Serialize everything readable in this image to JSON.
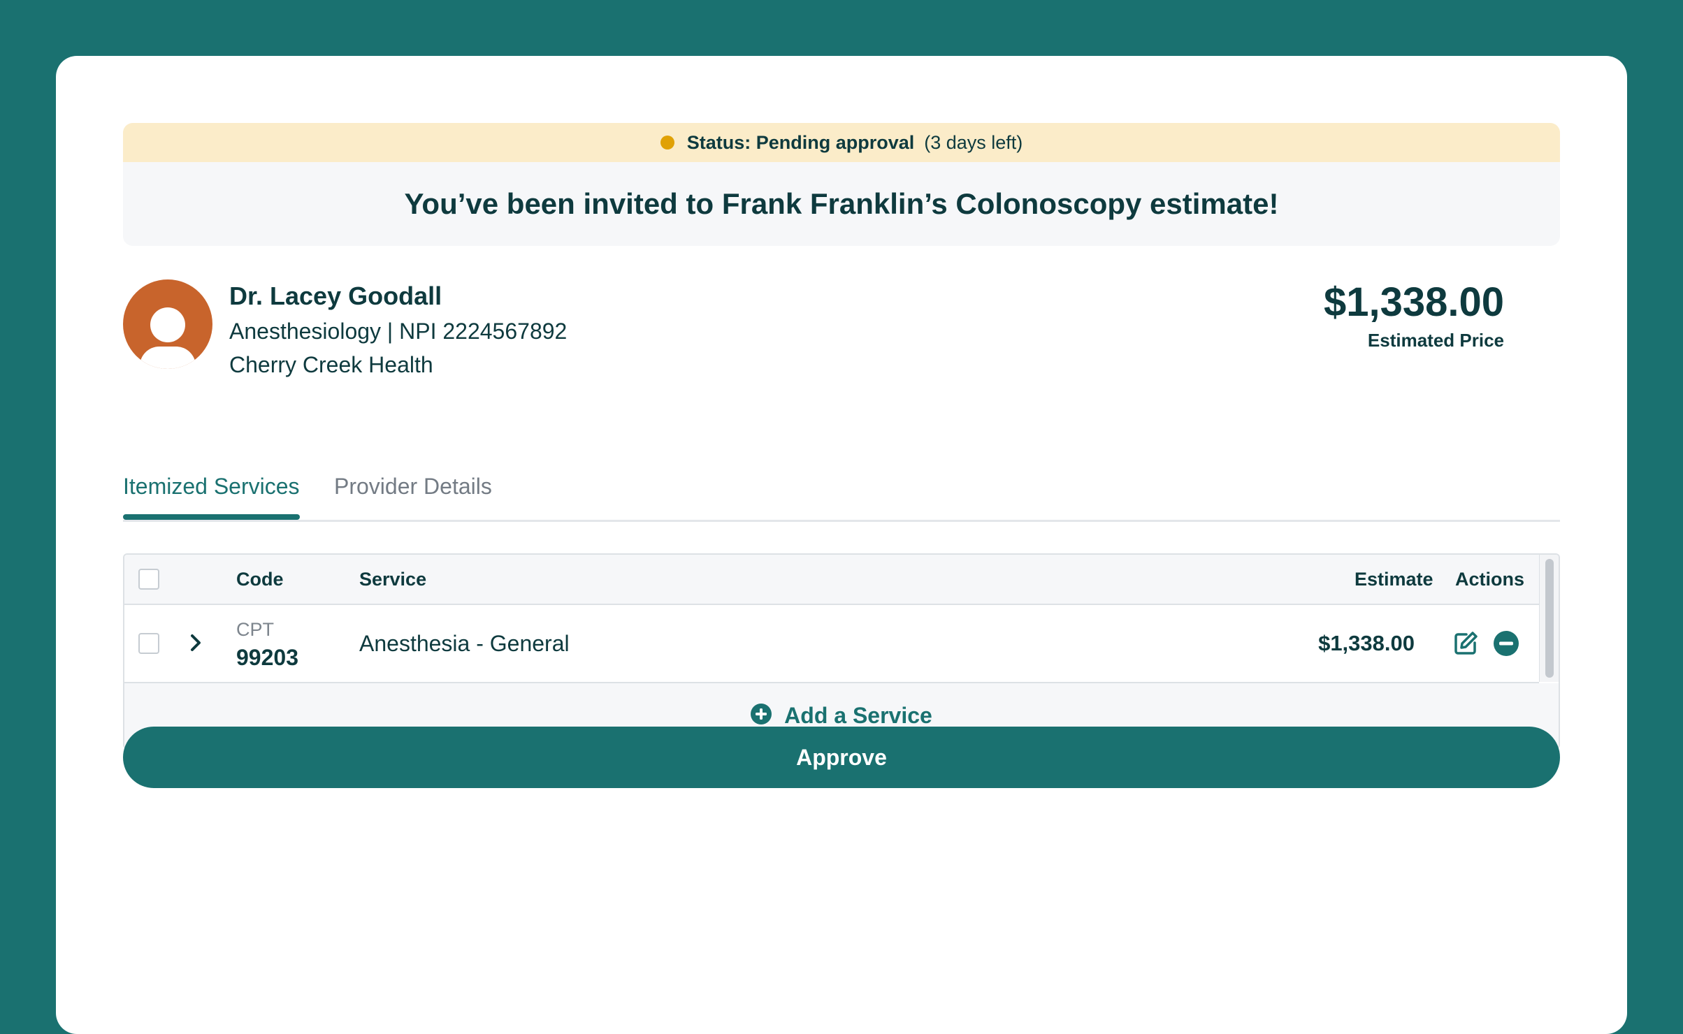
{
  "banner": {
    "status_label": "Status: Pending approval",
    "status_days": "(3 days left)",
    "title": "You’ve been invited to Frank Franklin’s Colonoscopy estimate!"
  },
  "provider": {
    "name": "Dr. Lacey Goodall",
    "specialty_npi": "Anesthesiology | NPI 2224567892",
    "organization": "Cherry Creek Health"
  },
  "price": {
    "amount": "$1,338.00",
    "label": "Estimated Price"
  },
  "tabs": [
    {
      "label": "Itemized Services",
      "active": true
    },
    {
      "label": "Provider Details",
      "active": false
    }
  ],
  "table": {
    "headers": {
      "code": "Code",
      "service": "Service",
      "estimate": "Estimate",
      "actions": "Actions"
    },
    "rows": [
      {
        "code_type": "CPT",
        "code": "99203",
        "service": "Anesthesia - General",
        "estimate": "$1,338.00"
      }
    ],
    "add_service_label": "Add a Service"
  },
  "approve_label": "Approve",
  "colors": {
    "background": "#1a7170",
    "accent": "#1a7170",
    "status_dot": "#e0a106",
    "status_strip": "#fbecc9",
    "avatar": "#c8642c"
  },
  "icons": {
    "status": "status-dot-icon",
    "avatar": "user-avatar-icon",
    "expand": "chevron-right-icon",
    "edit": "edit-icon",
    "remove": "minus-circle-icon",
    "add": "plus-circle-icon"
  }
}
